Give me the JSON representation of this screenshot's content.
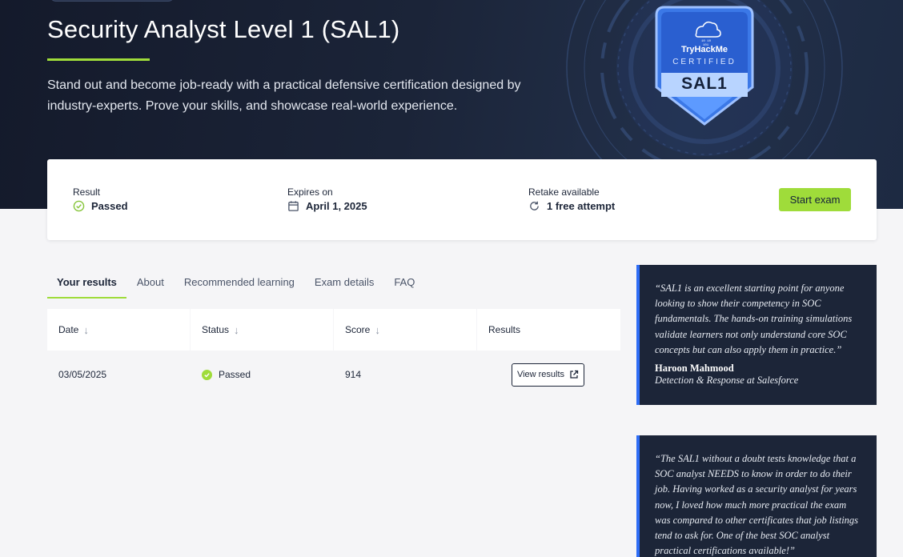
{
  "hero": {
    "title": "Security Analyst Level 1 (SAL1)",
    "description": "Stand out and become job-ready with a practical defensive certification designed by industry-experts. Prove your skills, and showcase real-world experience."
  },
  "badge": {
    "brand": "TryHackMe",
    "certified": "CERTIFIED",
    "code": "SAL1"
  },
  "status": {
    "result_label": "Result",
    "result_value": "Passed",
    "expires_label": "Expires on",
    "expires_value": "April 1, 2025",
    "retake_label": "Retake available",
    "retake_value": "1 free attempt",
    "start_button": "Start exam"
  },
  "tabs": [
    {
      "label": "Your results",
      "active": true
    },
    {
      "label": "About",
      "active": false
    },
    {
      "label": "Recommended learning",
      "active": false
    },
    {
      "label": "Exam details",
      "active": false
    },
    {
      "label": "FAQ",
      "active": false
    }
  ],
  "table": {
    "headers": [
      "Date",
      "Status",
      "Score",
      "Results"
    ],
    "rows": [
      {
        "date": "03/05/2025",
        "status": "Passed",
        "score": "914",
        "action": "View results"
      }
    ]
  },
  "quotes": [
    {
      "text": "“SAL1 is an excellent starting point for anyone looking to show their competency in SOC fundamentals. The hands-on training simulations validate learners not only understand core SOC concepts but can also apply them in practice.”",
      "author": "Haroon Mahmood",
      "role": "Detection & Response at Salesforce"
    },
    {
      "text": "“The SAL1 without a doubt tests knowledge that a SOC analyst NEEDS to know in order to do their job. Having worked as a security analyst for years now, I loved how much more practical the exam was compared to other certificates that job listings tend to ask for. One of the best SOC analyst practical certifications available!”"
    }
  ],
  "colors": {
    "accent_green": "#9fdc3a",
    "hero_dark": "#141a2b",
    "quote_bg": "#1c2538",
    "quote_border": "#2f6df5"
  }
}
